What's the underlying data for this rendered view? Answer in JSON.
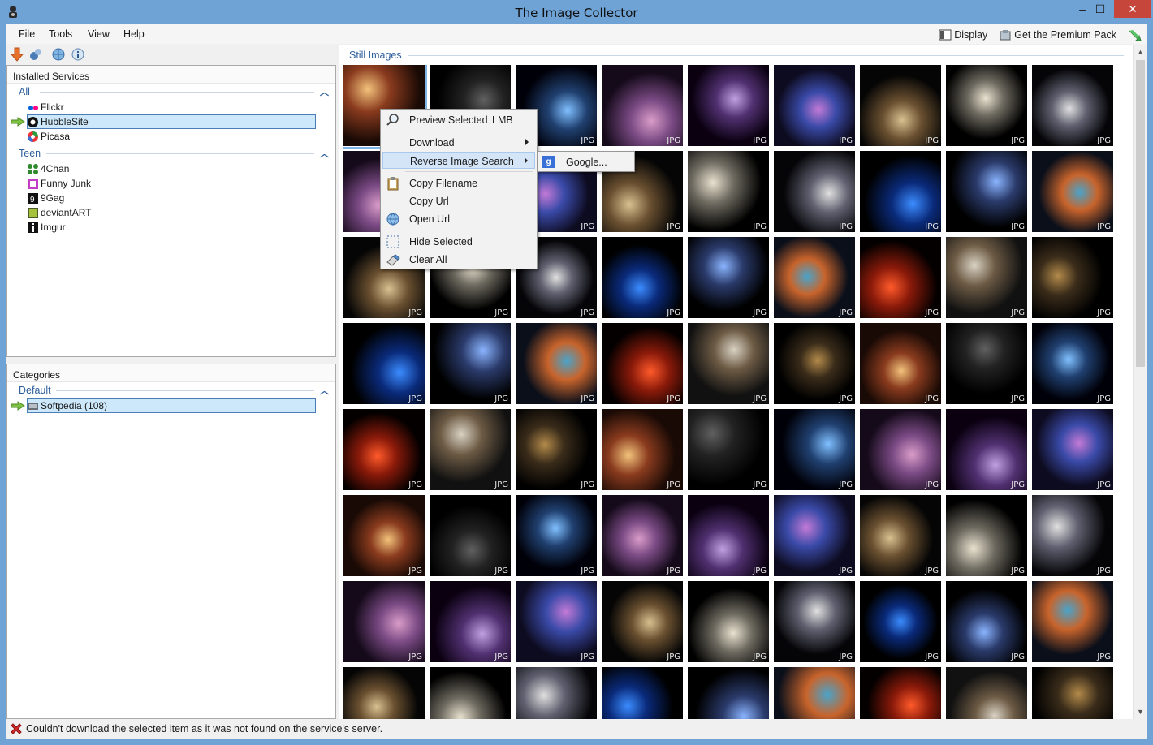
{
  "window": {
    "title": "The Image Collector"
  },
  "menu": [
    "File",
    "Tools",
    "View",
    "Help"
  ],
  "menubar_right": {
    "display": "Display",
    "premium": "Get the Premium Pack"
  },
  "services_panel": {
    "header": "Installed Services",
    "groups": [
      {
        "label": "All",
        "items": [
          {
            "label": "Flickr",
            "icon": "flickr-icon",
            "selected": false
          },
          {
            "label": "HubbleSite",
            "icon": "hubblesite-icon",
            "selected": true
          },
          {
            "label": "Picasa",
            "icon": "picasa-icon",
            "selected": false
          }
        ]
      },
      {
        "label": "Teen",
        "items": [
          {
            "label": "4Chan",
            "icon": "4chan-icon",
            "selected": false
          },
          {
            "label": "Funny Junk",
            "icon": "funnyjunk-icon",
            "selected": false
          },
          {
            "label": "9Gag",
            "icon": "9gag-icon",
            "selected": false
          },
          {
            "label": "deviantART",
            "icon": "deviantart-icon",
            "selected": false
          },
          {
            "label": "Imgur",
            "icon": "imgur-icon",
            "selected": false
          }
        ]
      }
    ]
  },
  "categories_panel": {
    "header": "Categories",
    "group": "Default",
    "items": [
      {
        "label": "Softpedia (108)",
        "selected": true
      }
    ]
  },
  "content": {
    "section_label": "Still Images",
    "thumb_ext": "JPG",
    "thumb_count": 72
  },
  "context_menu": {
    "items": [
      {
        "label": "Preview Selected",
        "shortcut": "LMB",
        "icon": "magnifier-icon"
      },
      {
        "label": "Download",
        "submenu": true
      },
      {
        "label": "Reverse Image Search",
        "submenu": true,
        "highlighted": true
      },
      {
        "label": "Copy Filename",
        "icon": "clipboard-icon"
      },
      {
        "label": "Copy Url"
      },
      {
        "label": "Open Url",
        "icon": "globe-icon"
      },
      {
        "label": "Hide Selected",
        "icon": "selection-icon"
      },
      {
        "label": "Clear All",
        "icon": "eraser-icon"
      }
    ],
    "submenu": {
      "label": "Google..."
    }
  },
  "status": {
    "message": "Couldn't download the selected item as it was not found on the service's server."
  }
}
